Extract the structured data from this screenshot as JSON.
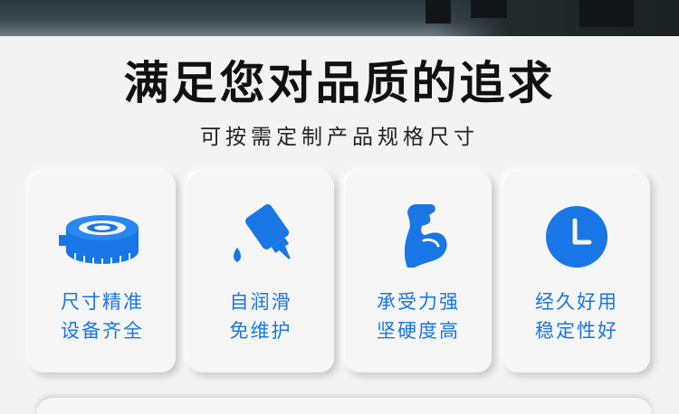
{
  "header": {
    "title": "满足您对品质的追求",
    "subtitle": "可按需定制产品规格尺寸"
  },
  "features": [
    {
      "icon": "tape-measure-icon",
      "line1": "尺寸精准",
      "line2": "设备齐全"
    },
    {
      "icon": "oil-dropper-icon",
      "line1": "自润滑",
      "line2": "免维护"
    },
    {
      "icon": "strong-arm-icon",
      "line1": "承受力强",
      "line2": "坚硬度高"
    },
    {
      "icon": "clock-icon",
      "line1": "经久好用",
      "line2": "稳定性好"
    }
  ],
  "colors": {
    "accent": "#1876e6",
    "title": "#111111",
    "background": "#f3f3f3"
  }
}
